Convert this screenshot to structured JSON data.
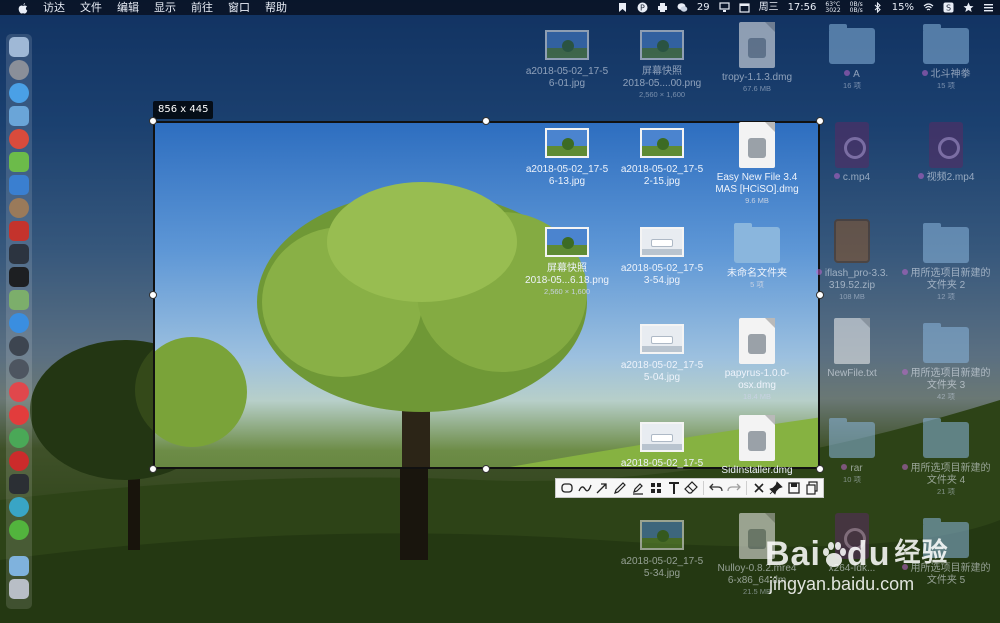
{
  "menubar": {
    "items": [
      "访达",
      "文件",
      "编辑",
      "显示",
      "前往",
      "窗口",
      "帮助"
    ],
    "notification_count": "29",
    "day": "周三",
    "time": "17:56",
    "temp_top": "63°C",
    "temp_bottom": "3022",
    "net_up": "0B/s",
    "net_down": "0B/s",
    "battery": "15%"
  },
  "selection": {
    "size_label": "856 x 445"
  },
  "desktop_files": [
    {
      "name": "a2018-05-02_17-5",
      "name2": "6-01.jpg",
      "sub": ""
    },
    {
      "name": "屏幕快照",
      "name2": "2018-05....00.png",
      "sub": "2,560 × 1,600"
    },
    {
      "name": "tropy-1.1.3.dmg",
      "name2": "",
      "sub": "67.6 MB"
    },
    {
      "name": "A",
      "name2": "",
      "sub": "16 项"
    },
    {
      "name": "北斗神拳",
      "name2": "",
      "sub": "15 项"
    },
    {
      "name": "a2018-05-02_17-5",
      "name2": "6-13.jpg",
      "sub": ""
    },
    {
      "name": "a2018-05-02_17-5",
      "name2": "2-15.jpg",
      "sub": ""
    },
    {
      "name": "Easy New File 3.4",
      "name2": "MAS [HCiSO].dmg",
      "sub": "9.6 MB"
    },
    {
      "name": "c.mp4",
      "name2": "",
      "sub": ""
    },
    {
      "name": "视频2.mp4",
      "name2": "",
      "sub": ""
    },
    {
      "name": "屏幕快照",
      "name2": "2018-05...6.18.png",
      "sub": "2,560 × 1,600"
    },
    {
      "name": "a2018-05-02_17-5",
      "name2": "3-54.jpg",
      "sub": ""
    },
    {
      "name": "未命名文件夹",
      "name2": "",
      "sub": "5 项"
    },
    {
      "name": "iflash_pro-3.3.",
      "name2": "319.52.zip",
      "sub": "108 MB"
    },
    {
      "name": "用所选项目新建的",
      "name2": "文件夹 2",
      "sub": "12 项"
    },
    {
      "name": "a2018-05-02_17-5",
      "name2": "5-04.jpg",
      "sub": ""
    },
    {
      "name": "papyrus-1.0.0-",
      "name2": "osx.dmg",
      "sub": "18.4 MB"
    },
    {
      "name": "NewFile.txt",
      "name2": "",
      "sub": ""
    },
    {
      "name": "用所选项目新建的",
      "name2": "文件夹 3",
      "sub": "42 项"
    },
    {
      "name": "a2018-05-02_17-5",
      "name2": "",
      "sub": ""
    },
    {
      "name": "SidInstaller.dmg",
      "name2": "",
      "sub": ""
    },
    {
      "name": "rar",
      "name2": "",
      "sub": "10 项"
    },
    {
      "name": "用所选项目新建的",
      "name2": "文件夹 4",
      "sub": "21 项"
    },
    {
      "name": "a2018-05-02_17-5",
      "name2": "5-34.jpg",
      "sub": ""
    },
    {
      "name": "Nulloy-0.8.2.mre4",
      "name2": "6-x86_64.dm",
      "sub": "21.5 MB"
    },
    {
      "name": "x264-fdk...",
      "name2": "",
      "sub": ""
    },
    {
      "name": "用所选项目新建的",
      "name2": "文件夹 5",
      "sub": ""
    }
  ],
  "watermark": {
    "brand": "Bai",
    "brand2": "du",
    "brand_cn": "经验",
    "url": "jingyan.baidu.com"
  },
  "toolbar_icons": [
    "rect-icon",
    "ellipse-icon",
    "line-icon",
    "arrow-icon",
    "pen-icon",
    "marker-icon",
    "mosaic-icon",
    "text-icon",
    "eraser-icon",
    "undo-icon",
    "redo-icon",
    "close-icon",
    "pin-icon",
    "save-icon",
    "copy-icon"
  ],
  "colors": {
    "menubar_bg": "#0e1626",
    "selection_border": "#111111",
    "toolbar_bg": "#f7f7f7"
  }
}
